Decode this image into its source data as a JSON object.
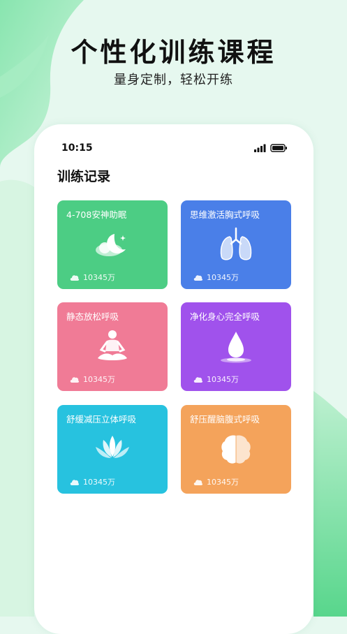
{
  "header": {
    "title": "个性化训练课程",
    "subtitle": "量身定制，轻松开练"
  },
  "status_bar": {
    "time": "10:15"
  },
  "section": {
    "title": "训练记录"
  },
  "cards": [
    {
      "title": "4-708安神助眠",
      "count": "10345万",
      "color": "#4ccd84",
      "icon": "moon-icon"
    },
    {
      "title": "思维激活胸式呼吸",
      "count": "10345万",
      "color": "#4a7fe8",
      "icon": "lungs-icon"
    },
    {
      "title": "静态放松呼吸",
      "count": "10345万",
      "color": "#f07b96",
      "icon": "meditation-icon"
    },
    {
      "title": "净化身心完全呼吸",
      "count": "10345万",
      "color": "#a052ec",
      "icon": "water-drop-icon"
    },
    {
      "title": "舒缓减压立体呼吸",
      "count": "10345万",
      "color": "#27c2df",
      "icon": "lotus-icon"
    },
    {
      "title": "舒压醒脑腹式呼吸",
      "count": "10345万",
      "color": "#f4a35b",
      "icon": "brain-icon"
    }
  ]
}
